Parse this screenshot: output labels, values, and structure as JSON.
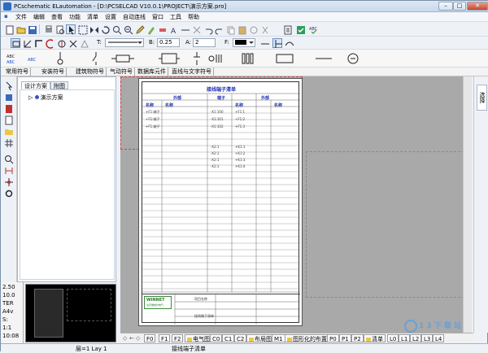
{
  "window": {
    "title": "PCschematic ELautomation - [D:\\PCSELCAD V10.0.1\\PROJECT\\演示方案.pro]",
    "buttons": {
      "minimize": "–",
      "maximize": "□",
      "close": "✕"
    }
  },
  "menu": [
    "文件",
    "编辑",
    "查看",
    "功能",
    "清单",
    "设置",
    "自动连线",
    "窗口",
    "工具",
    "帮助"
  ],
  "toolbar2": {
    "t_label": "T:",
    "b_label": "B:",
    "b_value": "0.25",
    "a_label": "A:",
    "a_value": "2",
    "f_label": "F:"
  },
  "symbol_tabs": [
    "常用符号",
    "安装符号",
    "建筑物符号",
    "气动符号",
    "数据库元件",
    "直线与文字符号"
  ],
  "panel": {
    "tabs": [
      "设计方案",
      "附图"
    ],
    "tree_root": "演示方案"
  },
  "drawing": {
    "title": "接线端子清单",
    "headers": [
      "外部",
      "端子",
      "外部"
    ],
    "subheaders": [
      "名称",
      "名称",
      "名称",
      "名称"
    ],
    "rows": [
      [
        "+F1:端子",
        "-X1:100",
        "+F1:1"
      ],
      [
        "+F1:端子",
        "-X1:101",
        "+F1:2"
      ],
      [
        "+F1:端子",
        "-X1:102",
        "+F1:3"
      ],
      [
        "",
        "-X2:1",
        "+K1:1"
      ],
      [
        "",
        "-X2:1",
        "+K1:2"
      ],
      [
        "",
        "-X2:1",
        "+K1:3"
      ],
      [
        "",
        "-X2:1",
        "+K1:4"
      ]
    ],
    "logo_text": "WINNET",
    "logo_sub": "北京维纳尔电气",
    "tb_text1": "项目名称",
    "tb_text2": "接线端子清单"
  },
  "side_tab": "选择",
  "status_left": [
    "2.50",
    "10.0",
    "TER",
    "A4v",
    "S:",
    "1:1",
    "10:08"
  ],
  "page_tabs": [
    "F0",
    "F1",
    "F2",
    "电气图",
    "C0",
    "C1",
    "C2",
    "布局图",
    "M1",
    "图形化的布置",
    "P0",
    "P1",
    "P2",
    "清单",
    "L0",
    "L1",
    "L2",
    "L3",
    "L4"
  ],
  "page_tabs_folder": [
    "电气图",
    "布局图",
    "图形化的布置",
    "清单"
  ],
  "statusbar": {
    "layer": "层=1 Lay 1",
    "page": "接线端子清单"
  },
  "watermark": "1 3 下 载 站"
}
